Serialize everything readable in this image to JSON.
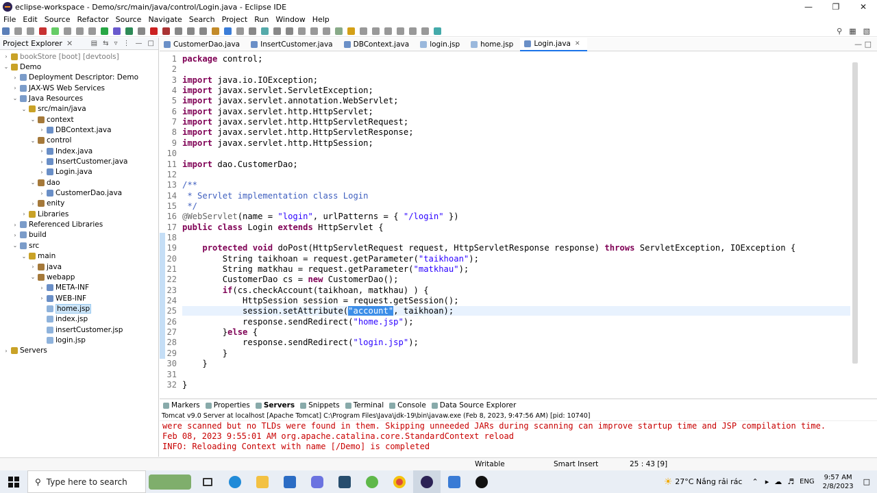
{
  "window": {
    "title": "eclipse-workspace - Demo/src/main/java/control/Login.java - Eclipse IDE"
  },
  "menu": [
    "File",
    "Edit",
    "Source",
    "Refactor",
    "Source",
    "Navigate",
    "Search",
    "Project",
    "Run",
    "Window",
    "Help"
  ],
  "explorer": {
    "title": "Project Explorer",
    "items": [
      {
        "label": "bookStore [boot] [devtools]",
        "level": 0,
        "arrow": "›",
        "muted": true
      },
      {
        "label": "Demo",
        "level": 0,
        "arrow": "⌄"
      },
      {
        "label": "Deployment Descriptor: Demo",
        "level": 1,
        "arrow": "›"
      },
      {
        "label": "JAX-WS Web Services",
        "level": 1,
        "arrow": "›"
      },
      {
        "label": "Java Resources",
        "level": 1,
        "arrow": "⌄"
      },
      {
        "label": "src/main/java",
        "level": 2,
        "arrow": "⌄"
      },
      {
        "label": "context",
        "level": 3,
        "arrow": "⌄"
      },
      {
        "label": "DBContext.java",
        "level": 4,
        "arrow": "›"
      },
      {
        "label": "control",
        "level": 3,
        "arrow": "⌄"
      },
      {
        "label": "Index.java",
        "level": 4,
        "arrow": "›"
      },
      {
        "label": "InsertCustomer.java",
        "level": 4,
        "arrow": "›"
      },
      {
        "label": "Login.java",
        "level": 4,
        "arrow": "›"
      },
      {
        "label": "dao",
        "level": 3,
        "arrow": "⌄"
      },
      {
        "label": "CustomerDao.java",
        "level": 4,
        "arrow": "›"
      },
      {
        "label": "enity",
        "level": 3,
        "arrow": "›"
      },
      {
        "label": "Libraries",
        "level": 2,
        "arrow": "›"
      },
      {
        "label": "Referenced Libraries",
        "level": 1,
        "arrow": "›"
      },
      {
        "label": "build",
        "level": 1,
        "arrow": "›"
      },
      {
        "label": "src",
        "level": 1,
        "arrow": "⌄"
      },
      {
        "label": "main",
        "level": 2,
        "arrow": "⌄"
      },
      {
        "label": "java",
        "level": 3,
        "arrow": "›"
      },
      {
        "label": "webapp",
        "level": 3,
        "arrow": "⌄"
      },
      {
        "label": "META-INF",
        "level": 4,
        "arrow": "›"
      },
      {
        "label": "WEB-INF",
        "level": 4,
        "arrow": "›"
      },
      {
        "label": "home.jsp",
        "level": 4,
        "arrow": "",
        "selected": true
      },
      {
        "label": "index.jsp",
        "level": 4,
        "arrow": ""
      },
      {
        "label": "insertCustomer.jsp",
        "level": 4,
        "arrow": ""
      },
      {
        "label": "login.jsp",
        "level": 4,
        "arrow": ""
      },
      {
        "label": "Servers",
        "level": 0,
        "arrow": "›"
      }
    ]
  },
  "tabs": [
    {
      "label": "CustomerDao.java"
    },
    {
      "label": "InsertCustomer.java"
    },
    {
      "label": "DBContext.java"
    },
    {
      "label": "login.jsp"
    },
    {
      "label": "home.jsp"
    },
    {
      "label": "Login.java",
      "active": true
    }
  ],
  "code": {
    "current_line": 25,
    "lines": [
      "package control;",
      "",
      "import java.io.IOException;",
      "import javax.servlet.ServletException;",
      "import javax.servlet.annotation.WebServlet;",
      "import javax.servlet.http.HttpServlet;",
      "import javax.servlet.http.HttpServletRequest;",
      "import javax.servlet.http.HttpServletResponse;",
      "import javax.servlet.http.HttpSession;",
      "",
      "import dao.CustomerDao;",
      "",
      "/**",
      " * Servlet implementation class Login",
      " */",
      "@WebServlet(name = \"login\", urlPatterns = { \"/login\" })",
      "public class Login extends HttpServlet {",
      "",
      "    protected void doPost(HttpServletRequest request, HttpServletResponse response) throws ServletException, IOException {",
      "        String taikhoan = request.getParameter(\"taikhoan\");",
      "        String matkhau = request.getParameter(\"matkhau\");",
      "        CustomerDao cs = new CustomerDao();",
      "        if(cs.checkAccount(taikhoan, matkhau) ) {",
      "            HttpSession session = request.getSession();",
      "            session.setAttribute(\"account\", taikhoan);",
      "            response.sendRedirect(\"home.jsp\");",
      "        }else {",
      "            response.sendRedirect(\"login.jsp\");",
      "        }",
      "    }",
      "",
      "}"
    ]
  },
  "bottom_tabs": [
    "Markers",
    "Properties",
    "Servers",
    "Snippets",
    "Terminal",
    "Console",
    "Data Source Explorer"
  ],
  "bottom_active": "Servers",
  "console": {
    "title": "Tomcat v9.0 Server at localhost [Apache Tomcat] C:\\Program Files\\Java\\jdk-19\\bin\\javaw.exe  (Feb 8, 2023, 9:47:56 AM) [pid: 10740]",
    "lines": [
      "were scanned but no TLDs were found in them. Skipping unneeded JARs during scanning can improve startup time and JSP compilation time.",
      "Feb 08, 2023 9:55:01 AM org.apache.catalina.core.StandardContext reload",
      "INFO: Reloading Context with name [/Demo] is completed"
    ]
  },
  "status": {
    "writable": "Writable",
    "insert": "Smart Insert",
    "position": "25 : 43 [9]"
  },
  "taskbar": {
    "search_placeholder": "Type here to search",
    "weather": "27°C  Nắng rải rác",
    "lang": "ENG",
    "time": "9:57 AM",
    "date": "2/8/2023"
  }
}
